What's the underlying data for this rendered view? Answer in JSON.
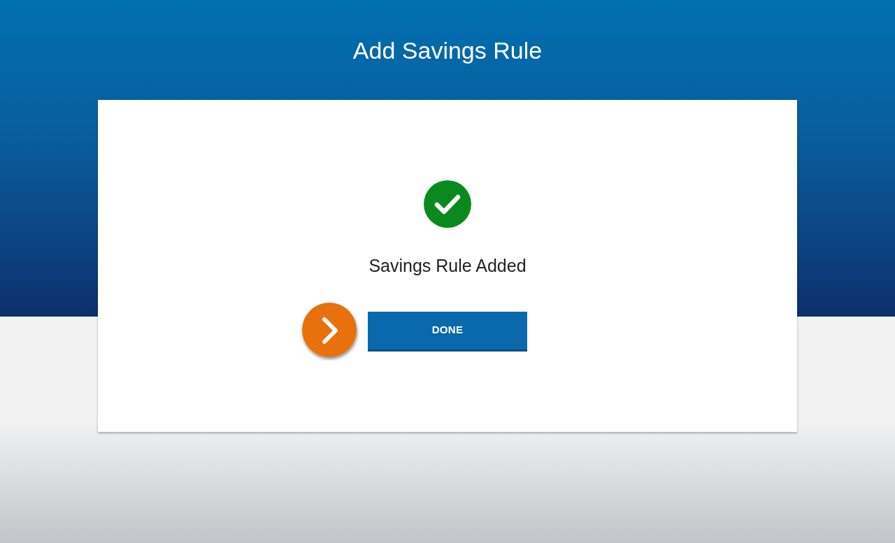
{
  "page": {
    "title": "Add Savings Rule"
  },
  "confirmation": {
    "kind": "success",
    "message": "Savings Rule Added"
  },
  "actions": [
    {
      "label": "DONE",
      "kind": "primary",
      "highlighted": true
    }
  ]
}
